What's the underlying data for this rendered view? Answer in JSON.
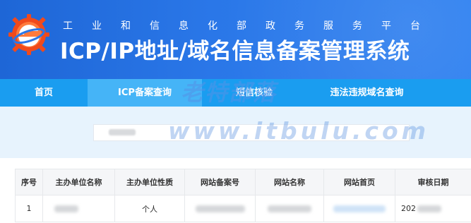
{
  "header": {
    "subtitle_chars": [
      "工",
      "业",
      "和",
      "信",
      "息",
      "化",
      "部",
      "政",
      "务",
      "服",
      "务",
      "平",
      "台"
    ],
    "title": "ICP/IP地址/域名信息备案管理系统",
    "logo_icon": "gear-globe-logo-icon"
  },
  "nav": {
    "items": [
      {
        "label": "首页",
        "active": false
      },
      {
        "label": "ICP备案查询",
        "active": true
      },
      {
        "label": "短信核验",
        "active": false
      },
      {
        "label": "违法违规域名查询",
        "active": false
      }
    ]
  },
  "search": {
    "value": ""
  },
  "watermark": {
    "cn": "老特部落",
    "en": "www.itbulu.com"
  },
  "table": {
    "headers": [
      "序号",
      "主办单位名称",
      "主办单位性质",
      "网站备案号",
      "网站名称",
      "网站首页",
      "审核日期"
    ],
    "rows": [
      {
        "index": "1",
        "org_name": "",
        "org_type": "个人",
        "record_no": "",
        "site_name": "",
        "homepage": "",
        "date": "202"
      }
    ]
  },
  "colors": {
    "header_blue": "#2a77e8",
    "nav_blue": "#1a9df0",
    "nav_active": "#45b4f7",
    "banner_bg": "#e7f3fd"
  }
}
